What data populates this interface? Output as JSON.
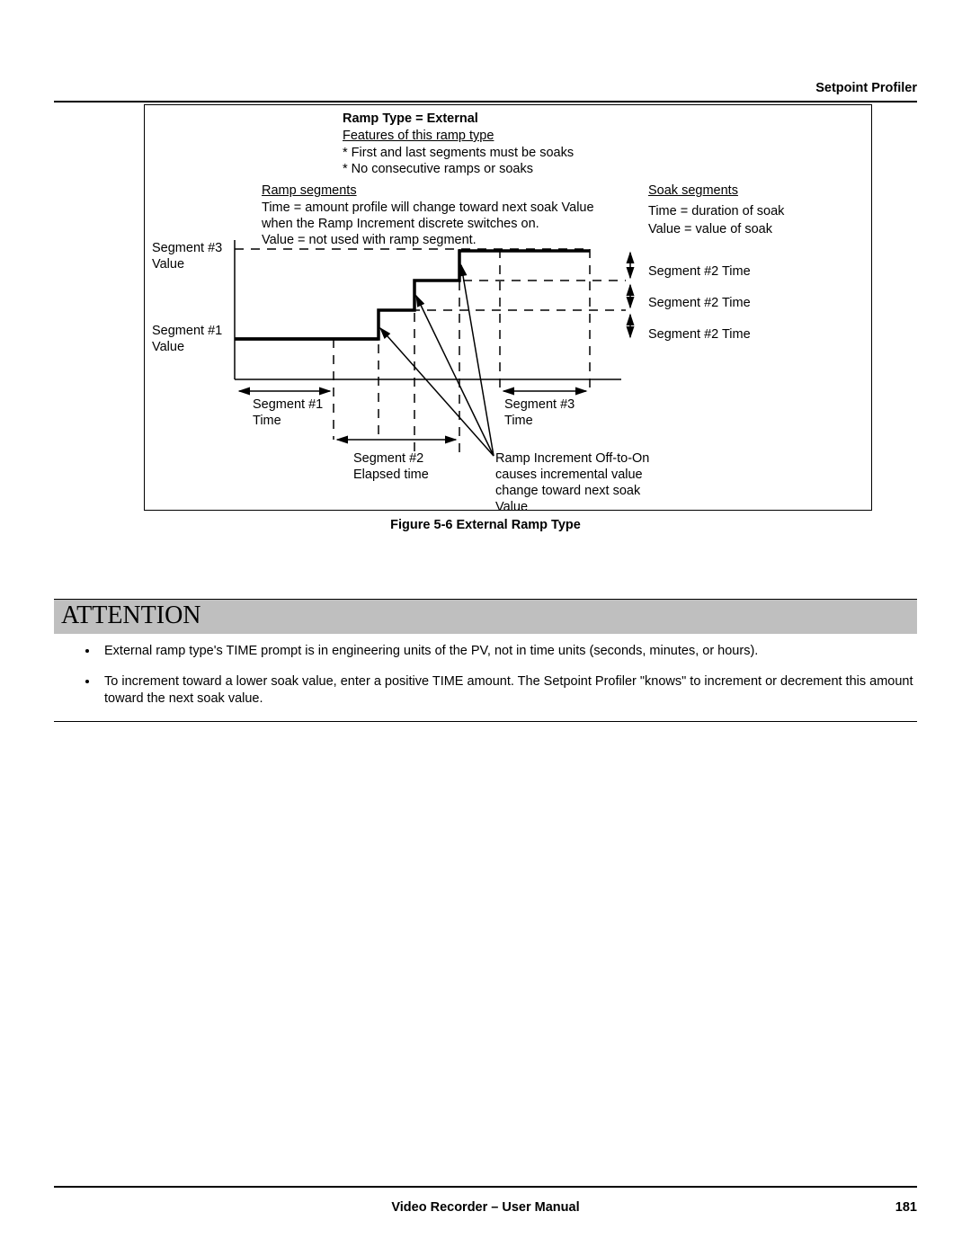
{
  "header": {
    "section": "Setpoint Profiler"
  },
  "figure": {
    "title": "Ramp Type = External",
    "features_heading": "Features of this ramp type",
    "feature_1": "* First and last segments must be soaks",
    "feature_2": "* No consecutive ramps or soaks",
    "ramp_heading": "Ramp segments",
    "ramp_line1": "Time = amount profile will change toward next soak Value",
    "ramp_line2": "when the Ramp Increment discrete switches on.",
    "ramp_line3": "Value = not used with ramp segment.",
    "soak_heading": "Soak segments",
    "soak_line1": "Time = duration of soak",
    "soak_line2": "Value  = value of soak",
    "left_label_top": "Segment #3\nValue",
    "left_label_mid": "Segment #1\nValue",
    "right_label_1": "Segment #2 Time",
    "right_label_2": "Segment #2 Time",
    "right_label_3": "Segment #2 Time",
    "bottom_seg1": "Segment #1\nTime",
    "bottom_seg3": "Segment #3\nTime",
    "bottom_seg2": "Segment #2\nElapsed time",
    "ramp_note": "Ramp Increment Off-to-On\ncauses incremental value\nchange toward next soak\nValue",
    "caption": "Figure 5-6   External Ramp Type"
  },
  "attention": {
    "title": "ATTENTION",
    "bullets": [
      "External ramp type's TIME prompt is in engineering units of the PV, not in time units (seconds, minutes, or hours).",
      "To increment toward a lower soak value, enter a positive TIME amount.  The Setpoint Profiler \"knows\" to increment or decrement this amount toward the next soak value."
    ]
  },
  "footer": {
    "title": "Video Recorder – User Manual",
    "page": "181"
  }
}
